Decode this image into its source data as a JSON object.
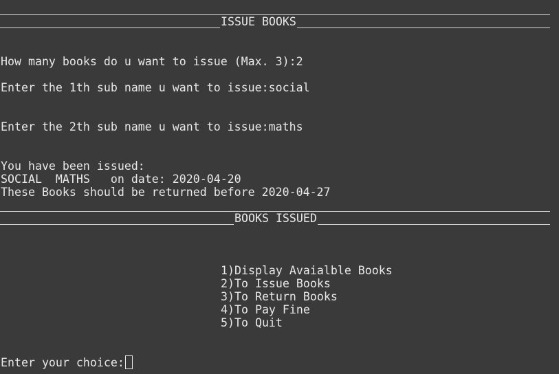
{
  "header": {
    "title": "ISSUE BOOKS"
  },
  "prompts": {
    "count_question": "How many books do u want to issue (Max. 3):",
    "count_answer": "2",
    "subject_1_question": "Enter the 1th sub name u want to issue:",
    "subject_1_answer": "social",
    "subject_2_question": "Enter the 2th sub name u want to issue:",
    "subject_2_answer": "maths"
  },
  "result": {
    "issued_heading": "You have been issued:",
    "issued_books": "SOCIAL  MATHS   on date: 2020-04-20",
    "return_note": "These Books should be returned before 2020-04-27"
  },
  "section": {
    "title": "BOOKS ISSUED"
  },
  "menu": {
    "items": [
      "1)Display Avaialble Books",
      "2)To Issue Books",
      "3)To Return Books",
      "4)To Pay Fine",
      "5)To Quit"
    ]
  },
  "input": {
    "choice_prompt": "Enter your choice:"
  }
}
